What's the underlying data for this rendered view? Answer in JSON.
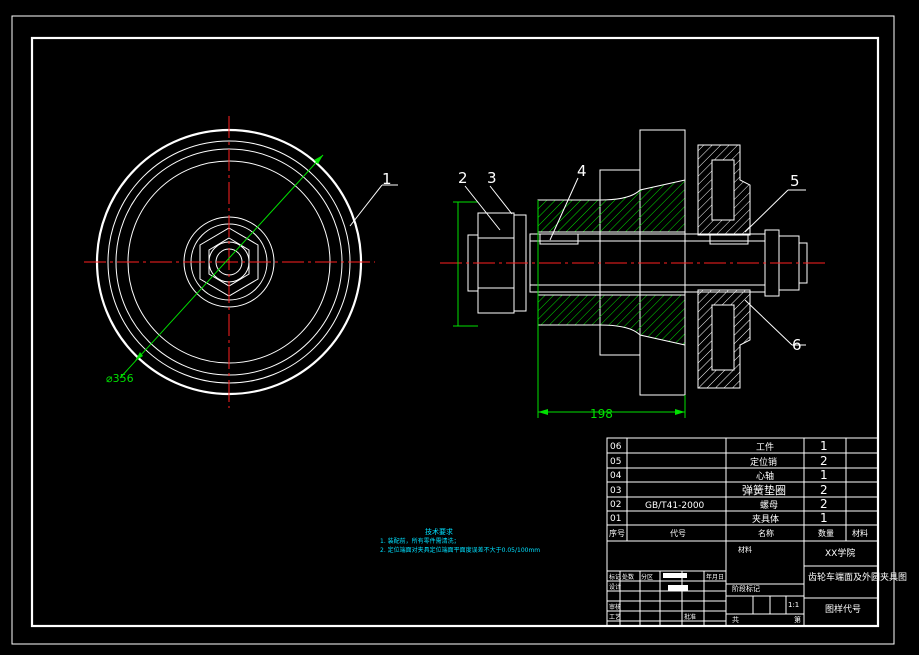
{
  "drawing": {
    "callouts": [
      "1",
      "2",
      "3",
      "4",
      "5",
      "6"
    ],
    "dims": {
      "diameter": "⌀356",
      "length": "198"
    },
    "notes": {
      "title": "技术要求",
      "line1": "1. 装配前，所有零件需清洗；",
      "line2": "2. 定位端面对夹具定位端面平面度误差不大于0.05/100mm"
    }
  },
  "bom": {
    "rows": [
      {
        "no": "06",
        "code": "",
        "name": "工件",
        "qty": "1"
      },
      {
        "no": "05",
        "code": "",
        "name": "定位销",
        "qty": "2"
      },
      {
        "no": "04",
        "code": "",
        "name": "心轴",
        "qty": "1"
      },
      {
        "no": "03",
        "code": "",
        "name": "弹簧垫圈",
        "qty": "2"
      },
      {
        "no": "02",
        "code": "GB/T41-2000",
        "name": "螺母",
        "qty": "2"
      },
      {
        "no": "01",
        "code": "",
        "name": "夹具体",
        "qty": "1"
      }
    ],
    "header": {
      "no": "序号",
      "code": "代号",
      "name": "名称",
      "qty": "数量",
      "material": "材料"
    }
  },
  "titleblock": {
    "material": "材料",
    "school": "XX学院",
    "title": "齿轮车端面及外圆夹具图",
    "drawing_no": "图样代号",
    "scale": "1:1",
    "stage": "阶段标记",
    "weight": "重量",
    "ratio": "比例",
    "sheet_total": "共",
    "sheet": "张",
    "of": "第",
    "left_labels": {
      "mark": "标记",
      "count": "处数",
      "zone": "分区",
      "change": "更改文件号",
      "sign": "签名",
      "date": "年月日",
      "design": "设计",
      "standard": "标准化",
      "check": "审核",
      "craft": "工艺",
      "approve": "批准"
    }
  },
  "colors": {
    "border": "#ffffff",
    "center": "#ff2020",
    "dim": "#00e000",
    "note": "#00e0ff",
    "hatch": "#00e000"
  }
}
